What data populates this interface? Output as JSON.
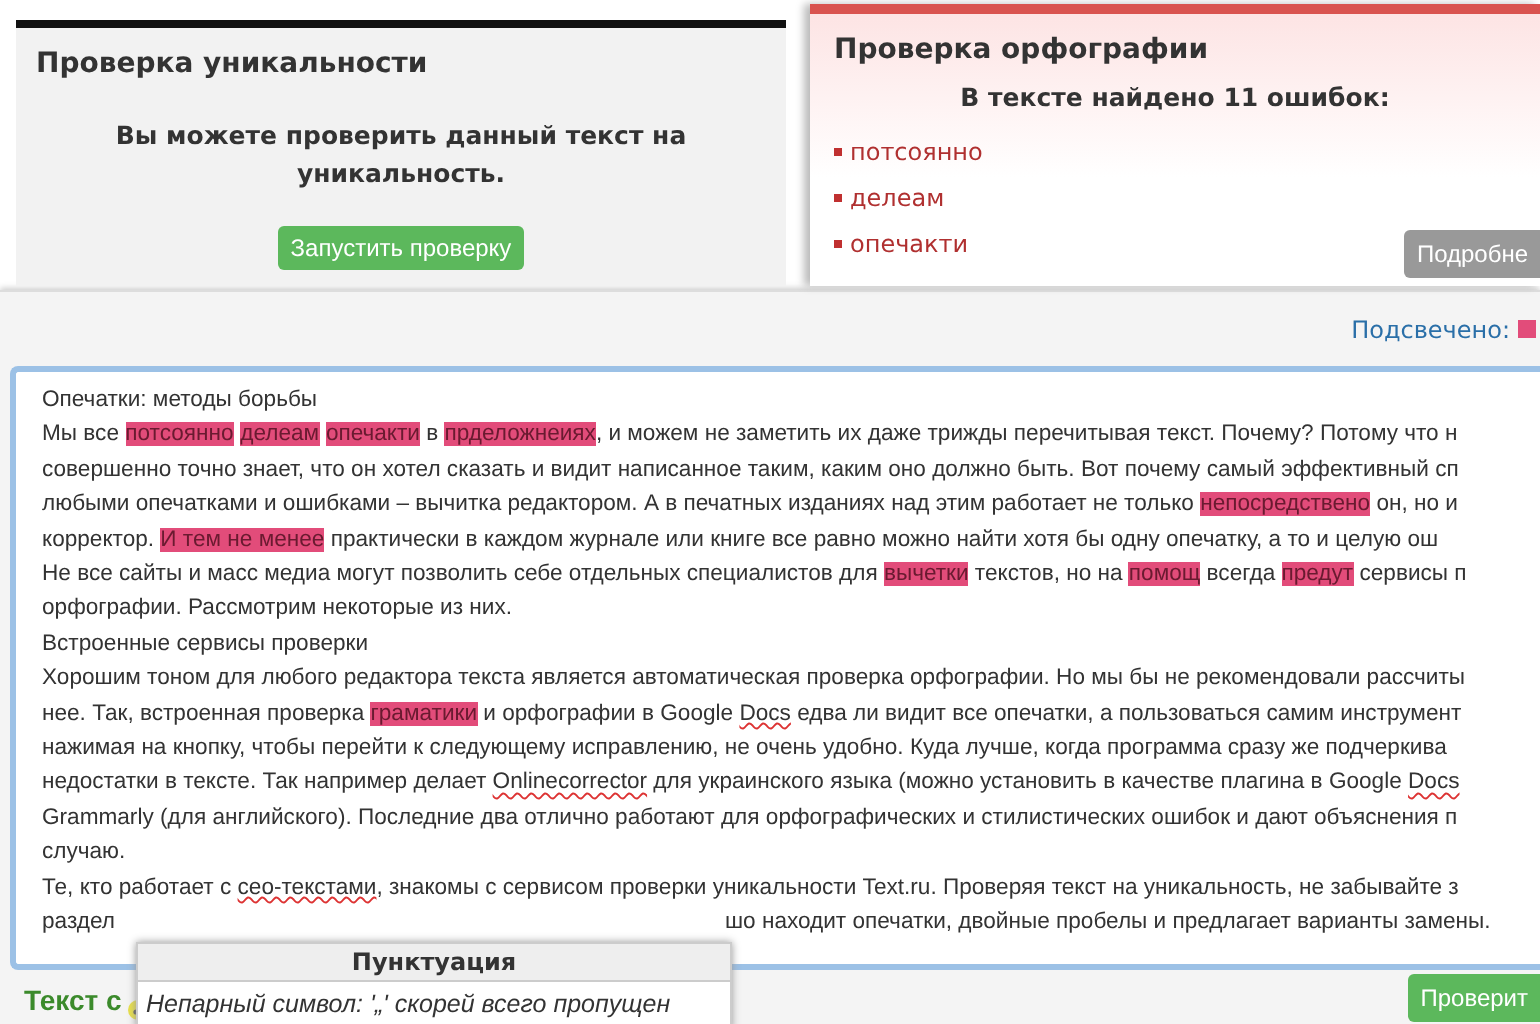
{
  "uniqueness_panel": {
    "title": "Проверка уникальности",
    "message": "Вы можете проверить данный текст на уникальность.",
    "button": "Запустить проверку"
  },
  "spelling_panel": {
    "title": "Проверка орфографии",
    "summary": "В тексте найдено 11 ошибок:",
    "errors": [
      "потсоянно",
      "делеам",
      "опечакти"
    ],
    "button": "Подробне"
  },
  "highlight_legend": {
    "label": "Подсвечено:"
  },
  "editor": {
    "lines": [
      {
        "segments": [
          {
            "kind": "plain",
            "text": "Опечатки: методы борьбы"
          }
        ]
      },
      {
        "segments": [
          {
            "kind": "plain",
            "text": "Мы все "
          },
          {
            "kind": "error",
            "text": "потсоянно"
          },
          {
            "kind": "error",
            "text": "делеам"
          },
          {
            "kind": "error",
            "text": "опечакти"
          },
          {
            "kind": "plain",
            "text": " в "
          },
          {
            "kind": "error",
            "text": "прделожнеиях"
          },
          {
            "kind": "plain",
            "text": ", и можем не заметить их даже трижды перечитывая текст. Почему? Потому что н"
          }
        ]
      },
      {
        "segments": [
          {
            "kind": "plain",
            "text": "совершенно точно знает, что он хотел сказать и видит написанное таким, каким оно должно быть. Вот почему самый эффективный сп"
          }
        ]
      },
      {
        "segments": [
          {
            "kind": "plain",
            "text": "любыми опечатками и ошибками – вычитка редактором. А в печатных изданиях над этим работает не только "
          },
          {
            "kind": "error",
            "text": "непосредствено"
          },
          {
            "kind": "plain",
            "text": " он, но и"
          }
        ]
      },
      {
        "segments": [
          {
            "kind": "plain",
            "text": "корректор. "
          },
          {
            "kind": "error",
            "text": "И тем не менее"
          },
          {
            "kind": "plain",
            "text": " практически в каждом журнале или книге все равно можно найти хотя бы одну опечатку, а то и целую ош"
          }
        ]
      },
      {
        "segments": [
          {
            "kind": "plain",
            "text": "Не все сайты и масс медиа могут позволить себе отдельных специалистов для "
          },
          {
            "kind": "error",
            "text": "вычетки"
          },
          {
            "kind": "plain",
            "text": " текстов, но на "
          },
          {
            "kind": "error",
            "text": "помощ"
          },
          {
            "kind": "plain",
            "text": " всегда "
          },
          {
            "kind": "error",
            "text": "предут"
          },
          {
            "kind": "plain",
            "text": " сервисы п"
          }
        ]
      },
      {
        "segments": [
          {
            "kind": "plain",
            "text": "орфографии. Рассмотрим некоторые из них."
          }
        ]
      },
      {
        "segments": [
          {
            "kind": "plain",
            "text": "Встроенные сервисы проверки"
          }
        ]
      },
      {
        "segments": [
          {
            "kind": "plain",
            "text": "Хорошим тоном для любого редактора текста является автоматическая проверка орфографии. Но мы бы не рекомендовали рассчиты"
          }
        ]
      },
      {
        "segments": [
          {
            "kind": "plain",
            "text": "нее. Так, встроенная проверка "
          },
          {
            "kind": "error",
            "text": "граматики"
          },
          {
            "kind": "plain",
            "text": " и орфографии в Google "
          },
          {
            "kind": "underline",
            "text": "Docs"
          },
          {
            "kind": "plain",
            "text": " едва ли видит все опечатки, а пользоваться самим инструмент"
          }
        ]
      },
      {
        "segments": [
          {
            "kind": "plain",
            "text": "нажимая на кнопку, чтобы перейти к следующему исправлению, не очень удобно. Куда лучше, когда программа сразу же подчеркива"
          }
        ]
      },
      {
        "segments": [
          {
            "kind": "plain",
            "text": "недостатки в тексте. Так например делает "
          },
          {
            "kind": "underline",
            "text": "Onlinecorrector"
          },
          {
            "kind": "plain",
            "text": " для украинского языка (можно установить в качестве плагина в Google "
          },
          {
            "kind": "underline",
            "text": "Docs"
          }
        ]
      },
      {
        "segments": [
          {
            "kind": "plain",
            "text": "Grammarly (для английского). Последние два отлично работают для орфографических и стилистических ошибок и дают объяснения п"
          }
        ]
      },
      {
        "segments": [
          {
            "kind": "plain",
            "text": "случаю."
          }
        ]
      },
      {
        "segments": [
          {
            "kind": "plain",
            "text": "Те, кто работает с "
          },
          {
            "kind": "underline",
            "text": "сео-текстами"
          },
          {
            "kind": "plain",
            "text": ", знакомы с сервисом проверки уникальности Text.ru. Проверяя текст на уникальность, не забывайте з"
          }
        ]
      },
      {
        "kind": "split",
        "segments": [
          {
            "kind": "plain",
            "text": "раздел"
          },
          {
            "kind": "plain",
            "text": "шо находит опечатки, двойные пробелы и предлагает варианты замены."
          }
        ]
      }
    ]
  },
  "tooltip": {
    "title": "Пунктуация",
    "message": "Непарный символ: '„' скорей всего пропущен"
  },
  "footer": {
    "title": "Текст с",
    "button": "Проверит"
  }
}
